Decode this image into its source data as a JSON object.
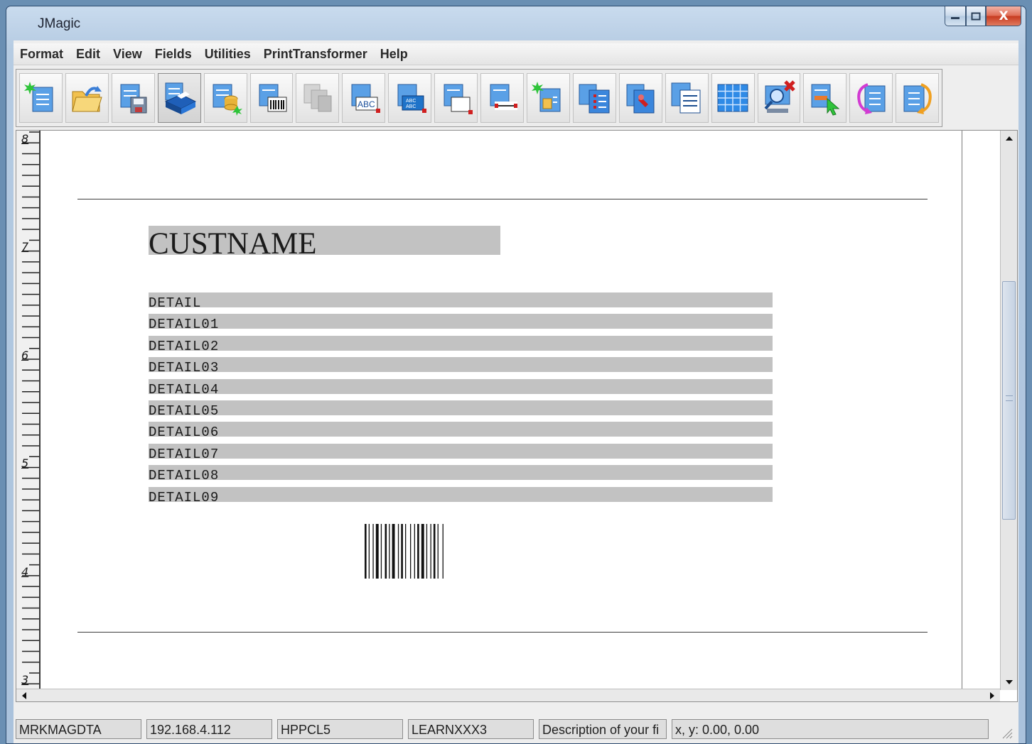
{
  "window": {
    "title": "JMagic"
  },
  "menu": [
    "Format",
    "Edit",
    "View",
    "Fields",
    "Utilities",
    "PrintTransformer",
    "Help"
  ],
  "toolbar": {
    "buttons": [
      {
        "name": "new-format-icon"
      },
      {
        "name": "open-format-icon"
      },
      {
        "name": "save-format-icon"
      },
      {
        "name": "print-icon"
      },
      {
        "name": "database-field-icon"
      },
      {
        "name": "barcode-field-icon"
      },
      {
        "name": "copy-field-icon"
      },
      {
        "name": "text-field-icon",
        "label": "ABC"
      },
      {
        "name": "multi-text-field-icon",
        "label": "ABC ABC"
      },
      {
        "name": "box-icon"
      },
      {
        "name": "line-icon"
      },
      {
        "name": "new-image-icon"
      },
      {
        "name": "list-icon"
      },
      {
        "name": "edit-field-icon"
      },
      {
        "name": "form-icon"
      },
      {
        "name": "grid-icon"
      },
      {
        "name": "delete-preview-icon"
      },
      {
        "name": "select-pointer-icon"
      },
      {
        "name": "import-icon"
      },
      {
        "name": "export-icon"
      }
    ]
  },
  "ruler": {
    "labels": [
      "8",
      "7",
      "6",
      "5",
      "4",
      "3"
    ]
  },
  "design": {
    "title_field": "CUSTNAME",
    "detail_fields": [
      "DETAIL",
      "DETAIL01",
      "DETAIL02",
      "DETAIL03",
      "DETAIL04",
      "DETAIL05",
      "DETAIL06",
      "DETAIL07",
      "DETAIL08",
      "DETAIL09"
    ]
  },
  "status": {
    "library": "MRKMAGDTA",
    "host": "192.168.4.112",
    "driver": "HPPCL5",
    "format": "LEARNXXX3",
    "description": "Description of your fi",
    "coords": "x, y:  0.00,  0.00"
  },
  "colors": {
    "field_fill": "#c2c2c2",
    "accent": "#3a7bd5"
  }
}
